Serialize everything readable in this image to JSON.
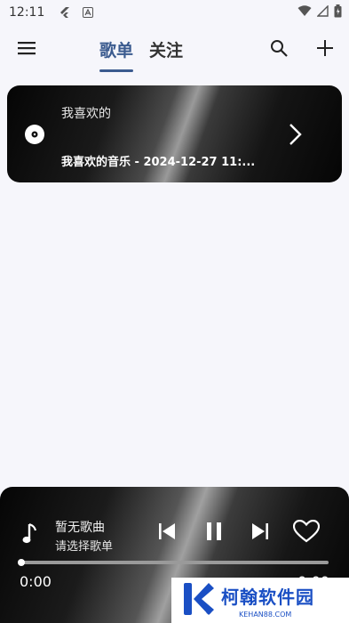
{
  "status_bar": {
    "time": "12:11"
  },
  "header": {
    "tabs": [
      {
        "label": "歌单",
        "active": true
      },
      {
        "label": "关注",
        "active": false
      }
    ],
    "icons": {
      "menu": "menu-icon",
      "search": "search-icon",
      "add": "add-icon"
    }
  },
  "playlists": [
    {
      "name": "我喜欢的",
      "description": "我喜欢的音乐 - 2024-12-27 11:..."
    }
  ],
  "player": {
    "title": "暂无歌曲",
    "subtitle": "请选择歌单",
    "current_time": "0:00",
    "duration": "0:00",
    "progress": 0
  },
  "watermark": {
    "text": "柯翰软件园",
    "sub": "KEHAN88.COM"
  },
  "colors": {
    "accent": "#3b5b8f",
    "background": "#f6f6fb",
    "watermark": "#1a4fc4"
  }
}
